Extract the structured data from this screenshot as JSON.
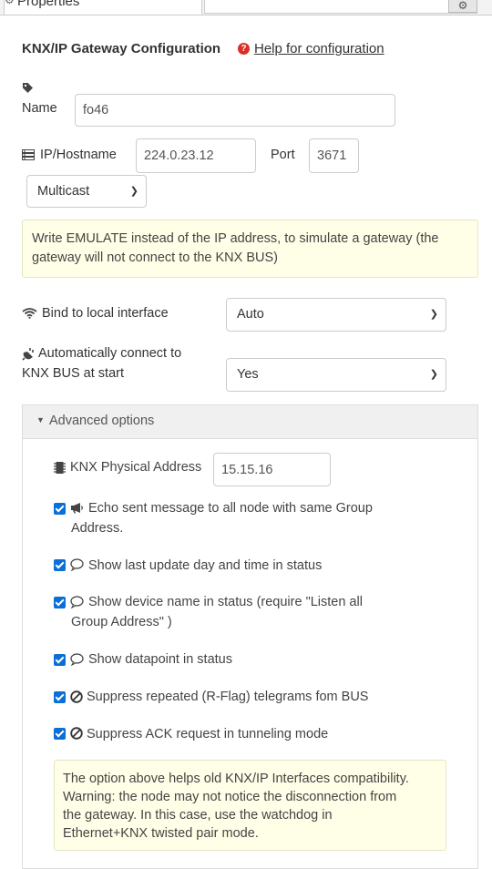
{
  "tabs": {
    "properties_label": "Properties"
  },
  "header": {
    "title": "KNX/IP Gateway Configuration",
    "help_link": "Help for configuration"
  },
  "name_field": {
    "label": "Name",
    "value": "fo46"
  },
  "ip_field": {
    "label": "IP/Hostname",
    "value": "224.0.23.12"
  },
  "port_field": {
    "label": "Port",
    "value": "3671"
  },
  "protocol_select": {
    "value": "Multicast"
  },
  "emulate_note": "Write EMULATE instead of the IP address, to simulate a gateway (the gateway will not connect to the KNX BUS)",
  "bind_interface": {
    "label": "Bind to local interface",
    "value": "Auto"
  },
  "autoconnect": {
    "label_line1": "Automatically connect to",
    "label_line2": "KNX BUS at start",
    "value": "Yes"
  },
  "advanced": {
    "title": "Advanced options",
    "physical_address": {
      "label": "KNX Physical Address",
      "value": "15.15.16"
    },
    "options": [
      {
        "line1": "Echo sent message to all node with same Group",
        "line2": "Address.",
        "checked": true,
        "icon": "bullhorn-icon"
      },
      {
        "line1": "Show last update day and time in status",
        "line2": "",
        "checked": true,
        "icon": "comment-icon"
      },
      {
        "line1": "Show device name in status (require \"Listen all",
        "line2": "Group Address\" )",
        "checked": true,
        "icon": "comment-icon"
      },
      {
        "line1": "Show datapoint in status",
        "line2": "",
        "checked": true,
        "icon": "comment-icon"
      },
      {
        "line1": "Suppress repeated (R-Flag) telegrams fom BUS",
        "line2": "",
        "checked": true,
        "icon": "ban-icon"
      },
      {
        "line1": "Suppress ACK request in tunneling mode",
        "line2": "",
        "checked": true,
        "icon": "ban-icon"
      }
    ],
    "compat_note": {
      "line1": "The option above helps old KNX/IP Interfaces compatibility.",
      "line2": "Warning: the node may not notice the disconnection from",
      "line3": "the gateway. In this case, use the watchdog in",
      "line4": "Ethernet+KNX twisted pair mode."
    }
  }
}
